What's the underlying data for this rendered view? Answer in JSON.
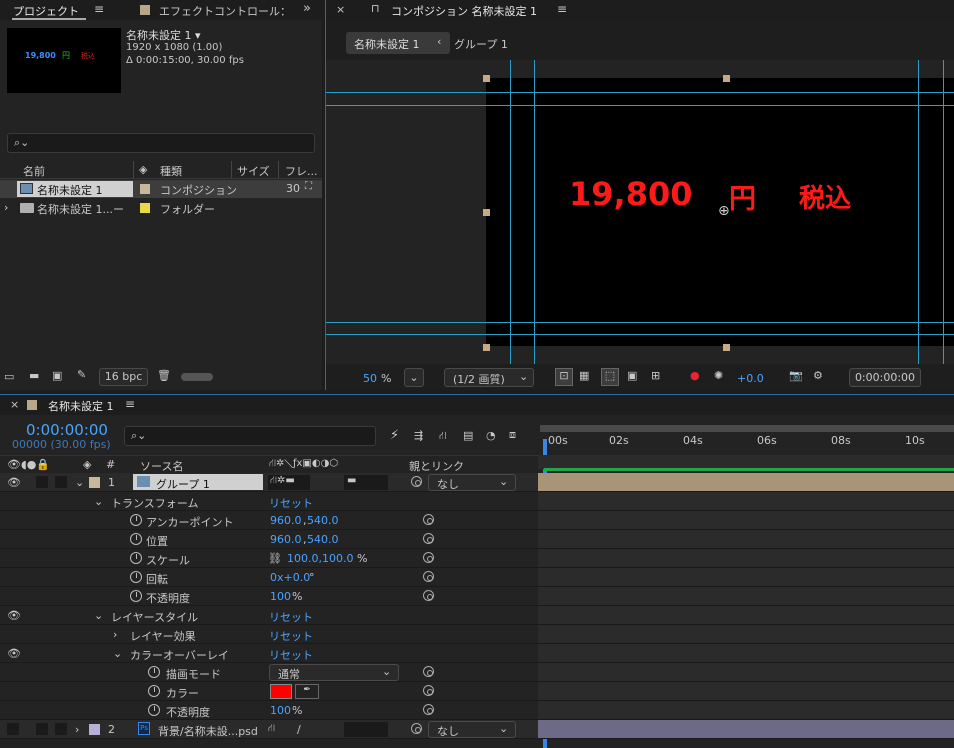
{
  "project_panel": {
    "tab_project": "プロジェクト",
    "tab_effect": "エフェクトコントロール：",
    "comp_name": "名称未設定 1 ▾",
    "comp_size": "1920 x 1080 (1.00)",
    "comp_duration": "Δ 0:00:15:00, 30.00 fps",
    "thumb_price": "19,800",
    "thumb_yen": "円",
    "thumb_tax": "税込",
    "search_placeholder": "",
    "columns": {
      "name": "名前",
      "type": "種類",
      "size": "サイズ",
      "frame": "フレ..."
    },
    "items": [
      {
        "name": "名称未設定 1",
        "type": "コンポジション",
        "frame": "30"
      },
      {
        "name": "名称未設定 1...ー",
        "type": "フォルダー",
        "frame": ""
      }
    ],
    "bpc": "16 bpc"
  },
  "comp_panel": {
    "tab_title": "コンポジション 名称未設定 1",
    "breadcrumb_comp": "名称未設定 1",
    "breadcrumb_group": "グループ 1",
    "canvas_price": "19,800",
    "canvas_yen": "円",
    "canvas_tax": "税込",
    "zoom_value": "50",
    "zoom_unit": "%",
    "resolution": "(1/2 画質)",
    "exposure": "+0.0",
    "timecode": "0:00:00:00"
  },
  "timeline": {
    "tab_title": "名称未設定 1",
    "current_time": "0:00:00:00",
    "frames": "00000 (30.00 fps)",
    "search_placeholder": "",
    "col_num": "#",
    "col_source": "ソース名",
    "col_parent": "親とリンク",
    "ruler": [
      "00s",
      "02s",
      "04s",
      "06s",
      "08s",
      "10s"
    ],
    "layers": [
      {
        "num": "1",
        "name": "グループ 1",
        "parent": "なし"
      },
      {
        "num": "2",
        "name": "背景/名称未設...psd",
        "parent": "なし"
      }
    ],
    "reset": "リセット",
    "transform": "トランスフォーム",
    "anchor": "アンカーポイント",
    "anchor_val_x": "960.0",
    "anchor_val_y": "540.0",
    "position": "位置",
    "position_val_x": "960.0",
    "position_val_y": "540.0",
    "scale": "スケール",
    "scale_val": "100.0,100.0",
    "scale_unit": "%",
    "rotation": "回転",
    "rotation_val": "0x+0.0",
    "rotation_unit": "°",
    "opacity": "不透明度",
    "opacity_val": "100",
    "percent": "%",
    "layer_style": "レイヤースタイル",
    "layer_effect": "レイヤー効果",
    "color_overlay": "カラーオーバーレイ",
    "blend_mode": "描画モード",
    "blend_value": "通常",
    "color": "カラー",
    "opacity2": "不透明度",
    "opacity2_val": "100",
    "ps_badge": "Ps"
  },
  "colors": {
    "accent_blue": "#4aa3ff",
    "price_red": "#ff1a1a",
    "guide": "#2aa0c8",
    "overlay_swatch": "#ff0000"
  }
}
